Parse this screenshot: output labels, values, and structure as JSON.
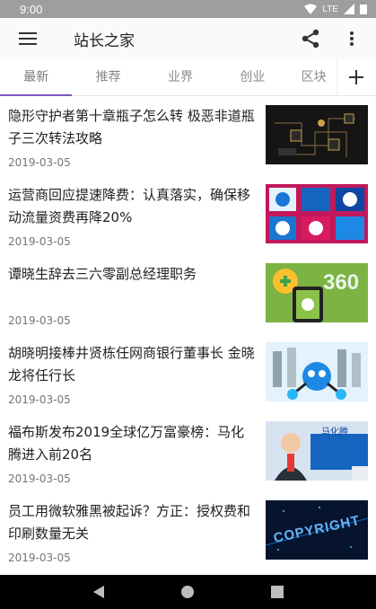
{
  "status": {
    "time": "9:00",
    "network": "LTE"
  },
  "appbar": {
    "title": "站长之家",
    "menu_icon": "menu-icon",
    "share_icon": "share-icon",
    "more_icon": "more-vert-icon"
  },
  "tabs": [
    "最新",
    "推荐",
    "业界",
    "创业",
    "区块"
  ],
  "active_tab": 0,
  "accent": "#7e57c2",
  "articles": [
    {
      "title": "隐形守护者第十章瓶子怎么转 极恶非道瓶子三次转法攻略",
      "date": "2019-03-05"
    },
    {
      "title": "运营商回应提速降费：认真落实，确保移动流量资费再降20%",
      "date": "2019-03-05"
    },
    {
      "title": "谭晓生辞去三六零副总经理职务",
      "date": "2019-03-05"
    },
    {
      "title": "胡晓明接棒井贤栋任网商银行董事长 金晓龙将任行长",
      "date": "2019-03-05"
    },
    {
      "title": "福布斯发布2019全球亿万富豪榜：马化腾进入前20名",
      "date": "2019-03-05"
    },
    {
      "title": "员工用微软雅黑被起诉？方正：授权费和印刷数量无关",
      "date": "2019-03-05"
    }
  ],
  "thumb_text": {
    "logo360": "360",
    "name_ma": "马化腾",
    "copyright": "COPYRIGHT"
  }
}
